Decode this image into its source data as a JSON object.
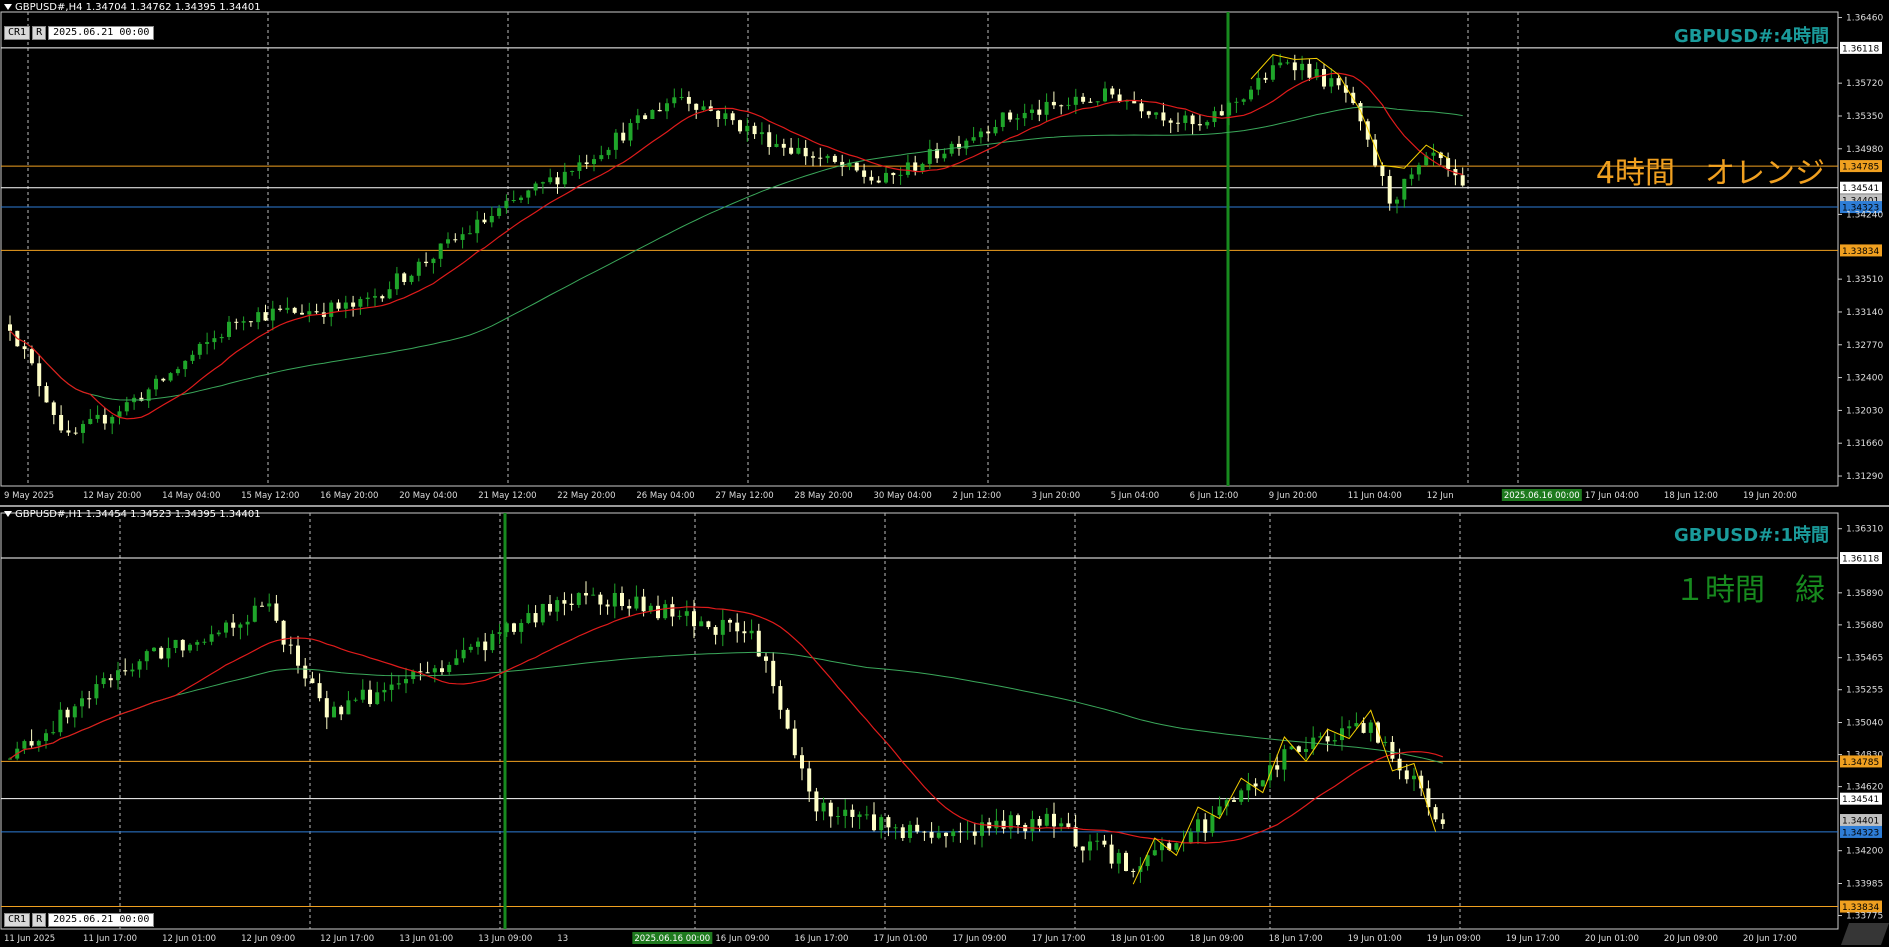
{
  "top": {
    "info": "GBPUSD#,H4  1.34704 1.34762 1.34395 1.34401",
    "cr": "CR1",
    "r": "R",
    "date": "2025.06.21 00:00",
    "title": "GBPUSD#:4時間",
    "note": "4時間　オレンジ",
    "price_ticks": [
      "1.36460",
      "1.36118",
      "1.35720",
      "1.35350",
      "1.34980",
      "1.34785",
      "1.34541",
      "1.34401",
      "1.34323",
      "1.34240",
      "1.33834",
      "1.33510",
      "1.33140",
      "1.32770",
      "1.32400",
      "1.32030",
      "1.31660",
      "1.31290"
    ],
    "time_ticks": [
      "9 May 2025",
      "12 May 20:00",
      "14 May 04:00",
      "15 May 12:00",
      "16 May 20:00",
      "20 May 04:00",
      "21 May 12:00",
      "22 May 20:00",
      "26 May 04:00",
      "27 May 12:00",
      "28 May 20:00",
      "30 May 04:00",
      "2 Jun 12:00",
      "3 Jun 20:00",
      "5 Jun 04:00",
      "6 Jun 12:00",
      "9 Jun 20:00",
      "11 Jun 04:00",
      "12 Jun",
      "2025.06.16 00:00",
      "17 Jun 04:00",
      "18 Jun 12:00",
      "19 Jun 20:00"
    ]
  },
  "bottom": {
    "info": "GBPUSD#,H1  1.34454 1.34523 1.34395 1.34401",
    "cr": "CR1",
    "r": "R",
    "date": "2025.06.21 00:00",
    "title": "GBPUSD#:1時間",
    "note": "１時間　緑",
    "price_ticks": [
      "1.36310",
      "1.36118",
      "1.35890",
      "1.35680",
      "1.35465",
      "1.35255",
      "1.35040",
      "1.34830",
      "1.34785",
      "1.34620",
      "1.34541",
      "1.34401",
      "1.34323",
      "1.34200",
      "1.33985",
      "1.33834",
      "1.33775"
    ],
    "time_ticks": [
      "11 Jun 2025",
      "11 Jun 17:00",
      "12 Jun 01:00",
      "12 Jun 09:00",
      "12 Jun 17:00",
      "13 Jun 01:00",
      "13 Jun 09:00",
      "13",
      "2025.06.16 00:00",
      "16 Jun 09:00",
      "16 Jun 17:00",
      "17 Jun 01:00",
      "17 Jun 09:00",
      "17 Jun 17:00",
      "18 Jun 01:00",
      "18 Jun 09:00",
      "18 Jun 17:00",
      "19 Jun 01:00",
      "19 Jun 09:00",
      "19 Jun 17:00",
      "20 Jun 01:00",
      "20 Jun 09:00",
      "20 Jun 17:00"
    ]
  },
  "colors": {
    "bull": "#1fa52a",
    "bear": "#ffffc8",
    "ma_fast": "#e01b1b",
    "ma_slow": "#3aa75a",
    "orange": "#f0a020",
    "blue": "#2e7dd6",
    "white": "#ffffff",
    "green": "#178a1e",
    "grid": "#bbbbbb"
  },
  "levels": {
    "resistance_top": "1.36118",
    "orange_upper": "1.34785",
    "white_mid": "1.34541",
    "current": "1.34401",
    "blue": "1.34323",
    "orange_lower": "1.33834"
  }
}
